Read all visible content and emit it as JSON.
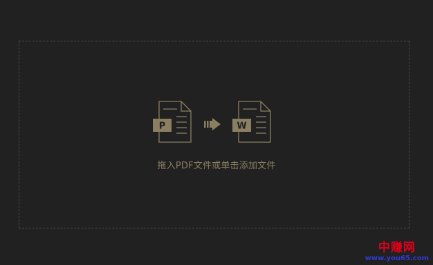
{
  "dropzone": {
    "prompt": "拖入PDF文件或单击添加文件"
  },
  "icons": {
    "source": {
      "name": "pdf-file-icon",
      "letter": "P"
    },
    "arrow": {
      "name": "arrow-right-icon"
    },
    "target": {
      "name": "word-file-icon",
      "letter": "W"
    }
  },
  "watermark": {
    "title": "中赚网",
    "url": "www.you65.com"
  },
  "colors": {
    "background": "#212121",
    "accent": "#8b7f62",
    "border": "#4a4a4a",
    "watermark_red": "#e0001a",
    "watermark_blue": "#2f3bd6"
  }
}
